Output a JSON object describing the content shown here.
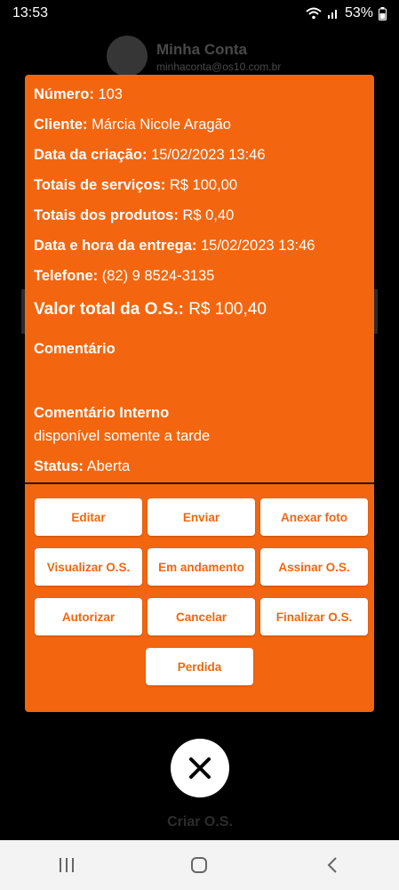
{
  "status_bar": {
    "time": "13:53",
    "battery": "53%"
  },
  "background": {
    "account_name": "Minha Conta",
    "account_email": "minhaconta@os10.com.br",
    "create_label": "Criar O.S."
  },
  "order": {
    "numero_label": "Número:",
    "numero_value": "103",
    "cliente_label": "Cliente:",
    "cliente_value": "Márcia Nicole Aragão",
    "criacao_label": "Data da criação:",
    "criacao_value": "15/02/2023 13:46",
    "servicos_label": "Totais de serviços:",
    "servicos_value": "R$ 100,00",
    "produtos_label": "Totais dos produtos:",
    "produtos_value": "R$ 0,40",
    "entrega_label": "Data e hora da entrega:",
    "entrega_value": "15/02/2023 13:46",
    "telefone_label": "Telefone:",
    "telefone_value": "(82) 9 8524-3135",
    "total_label": "Valor total da O.S.:",
    "total_value": "R$ 100,40",
    "comentario_title": "Comentário",
    "comentario_value": "",
    "comentario_interno_title": "Comentário Interno",
    "comentario_interno_value": "disponível somente a tarde",
    "status_label": "Status:",
    "status_value": "Aberta"
  },
  "buttons": {
    "editar": "Editar",
    "enviar": "Enviar",
    "anexar_foto": "Anexar foto",
    "visualizar": "Visualizar O.S.",
    "em_andamento": "Em andamento",
    "assinar": "Assinar O.S.",
    "autorizar": "Autorizar",
    "cancelar": "Cancelar",
    "finalizar": "Finalizar O.S.",
    "perdida": "Perdida"
  },
  "colors": {
    "accent": "#f3660f",
    "button_bg": "#ffffff"
  }
}
